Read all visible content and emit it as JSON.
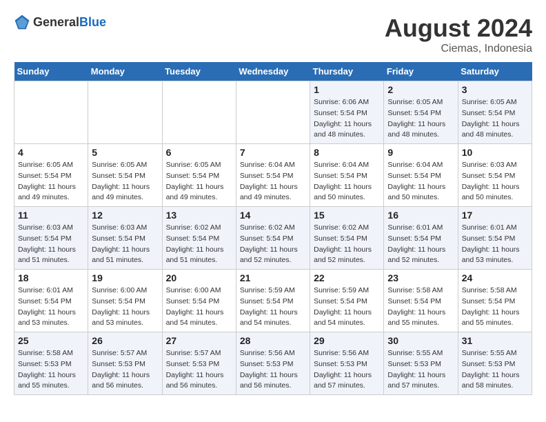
{
  "header": {
    "logo_general": "General",
    "logo_blue": "Blue",
    "month_year": "August 2024",
    "location": "Ciemas, Indonesia"
  },
  "weekdays": [
    "Sunday",
    "Monday",
    "Tuesday",
    "Wednesday",
    "Thursday",
    "Friday",
    "Saturday"
  ],
  "weeks": [
    [
      {
        "day": "",
        "sunrise": "",
        "sunset": "",
        "daylight": ""
      },
      {
        "day": "",
        "sunrise": "",
        "sunset": "",
        "daylight": ""
      },
      {
        "day": "",
        "sunrise": "",
        "sunset": "",
        "daylight": ""
      },
      {
        "day": "",
        "sunrise": "",
        "sunset": "",
        "daylight": ""
      },
      {
        "day": "1",
        "sunrise": "Sunrise: 6:06 AM",
        "sunset": "Sunset: 5:54 PM",
        "daylight": "Daylight: 11 hours and 48 minutes."
      },
      {
        "day": "2",
        "sunrise": "Sunrise: 6:05 AM",
        "sunset": "Sunset: 5:54 PM",
        "daylight": "Daylight: 11 hours and 48 minutes."
      },
      {
        "day": "3",
        "sunrise": "Sunrise: 6:05 AM",
        "sunset": "Sunset: 5:54 PM",
        "daylight": "Daylight: 11 hours and 48 minutes."
      }
    ],
    [
      {
        "day": "4",
        "sunrise": "Sunrise: 6:05 AM",
        "sunset": "Sunset: 5:54 PM",
        "daylight": "Daylight: 11 hours and 49 minutes."
      },
      {
        "day": "5",
        "sunrise": "Sunrise: 6:05 AM",
        "sunset": "Sunset: 5:54 PM",
        "daylight": "Daylight: 11 hours and 49 minutes."
      },
      {
        "day": "6",
        "sunrise": "Sunrise: 6:05 AM",
        "sunset": "Sunset: 5:54 PM",
        "daylight": "Daylight: 11 hours and 49 minutes."
      },
      {
        "day": "7",
        "sunrise": "Sunrise: 6:04 AM",
        "sunset": "Sunset: 5:54 PM",
        "daylight": "Daylight: 11 hours and 49 minutes."
      },
      {
        "day": "8",
        "sunrise": "Sunrise: 6:04 AM",
        "sunset": "Sunset: 5:54 PM",
        "daylight": "Daylight: 11 hours and 50 minutes."
      },
      {
        "day": "9",
        "sunrise": "Sunrise: 6:04 AM",
        "sunset": "Sunset: 5:54 PM",
        "daylight": "Daylight: 11 hours and 50 minutes."
      },
      {
        "day": "10",
        "sunrise": "Sunrise: 6:03 AM",
        "sunset": "Sunset: 5:54 PM",
        "daylight": "Daylight: 11 hours and 50 minutes."
      }
    ],
    [
      {
        "day": "11",
        "sunrise": "Sunrise: 6:03 AM",
        "sunset": "Sunset: 5:54 PM",
        "daylight": "Daylight: 11 hours and 51 minutes."
      },
      {
        "day": "12",
        "sunrise": "Sunrise: 6:03 AM",
        "sunset": "Sunset: 5:54 PM",
        "daylight": "Daylight: 11 hours and 51 minutes."
      },
      {
        "day": "13",
        "sunrise": "Sunrise: 6:02 AM",
        "sunset": "Sunset: 5:54 PM",
        "daylight": "Daylight: 11 hours and 51 minutes."
      },
      {
        "day": "14",
        "sunrise": "Sunrise: 6:02 AM",
        "sunset": "Sunset: 5:54 PM",
        "daylight": "Daylight: 11 hours and 52 minutes."
      },
      {
        "day": "15",
        "sunrise": "Sunrise: 6:02 AM",
        "sunset": "Sunset: 5:54 PM",
        "daylight": "Daylight: 11 hours and 52 minutes."
      },
      {
        "day": "16",
        "sunrise": "Sunrise: 6:01 AM",
        "sunset": "Sunset: 5:54 PM",
        "daylight": "Daylight: 11 hours and 52 minutes."
      },
      {
        "day": "17",
        "sunrise": "Sunrise: 6:01 AM",
        "sunset": "Sunset: 5:54 PM",
        "daylight": "Daylight: 11 hours and 53 minutes."
      }
    ],
    [
      {
        "day": "18",
        "sunrise": "Sunrise: 6:01 AM",
        "sunset": "Sunset: 5:54 PM",
        "daylight": "Daylight: 11 hours and 53 minutes."
      },
      {
        "day": "19",
        "sunrise": "Sunrise: 6:00 AM",
        "sunset": "Sunset: 5:54 PM",
        "daylight": "Daylight: 11 hours and 53 minutes."
      },
      {
        "day": "20",
        "sunrise": "Sunrise: 6:00 AM",
        "sunset": "Sunset: 5:54 PM",
        "daylight": "Daylight: 11 hours and 54 minutes."
      },
      {
        "day": "21",
        "sunrise": "Sunrise: 5:59 AM",
        "sunset": "Sunset: 5:54 PM",
        "daylight": "Daylight: 11 hours and 54 minutes."
      },
      {
        "day": "22",
        "sunrise": "Sunrise: 5:59 AM",
        "sunset": "Sunset: 5:54 PM",
        "daylight": "Daylight: 11 hours and 54 minutes."
      },
      {
        "day": "23",
        "sunrise": "Sunrise: 5:58 AM",
        "sunset": "Sunset: 5:54 PM",
        "daylight": "Daylight: 11 hours and 55 minutes."
      },
      {
        "day": "24",
        "sunrise": "Sunrise: 5:58 AM",
        "sunset": "Sunset: 5:54 PM",
        "daylight": "Daylight: 11 hours and 55 minutes."
      }
    ],
    [
      {
        "day": "25",
        "sunrise": "Sunrise: 5:58 AM",
        "sunset": "Sunset: 5:53 PM",
        "daylight": "Daylight: 11 hours and 55 minutes."
      },
      {
        "day": "26",
        "sunrise": "Sunrise: 5:57 AM",
        "sunset": "Sunset: 5:53 PM",
        "daylight": "Daylight: 11 hours and 56 minutes."
      },
      {
        "day": "27",
        "sunrise": "Sunrise: 5:57 AM",
        "sunset": "Sunset: 5:53 PM",
        "daylight": "Daylight: 11 hours and 56 minutes."
      },
      {
        "day": "28",
        "sunrise": "Sunrise: 5:56 AM",
        "sunset": "Sunset: 5:53 PM",
        "daylight": "Daylight: 11 hours and 56 minutes."
      },
      {
        "day": "29",
        "sunrise": "Sunrise: 5:56 AM",
        "sunset": "Sunset: 5:53 PM",
        "daylight": "Daylight: 11 hours and 57 minutes."
      },
      {
        "day": "30",
        "sunrise": "Sunrise: 5:55 AM",
        "sunset": "Sunset: 5:53 PM",
        "daylight": "Daylight: 11 hours and 57 minutes."
      },
      {
        "day": "31",
        "sunrise": "Sunrise: 5:55 AM",
        "sunset": "Sunset: 5:53 PM",
        "daylight": "Daylight: 11 hours and 58 minutes."
      }
    ]
  ]
}
